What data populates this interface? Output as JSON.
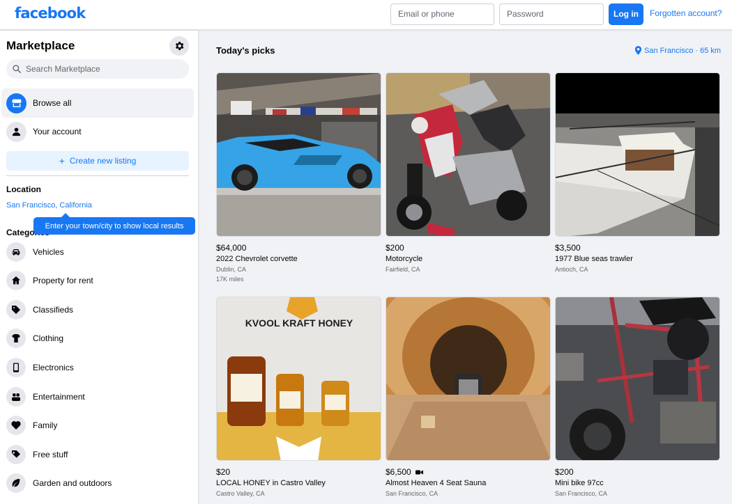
{
  "header": {
    "logo": "facebook",
    "email_placeholder": "Email or phone",
    "password_placeholder": "Password",
    "login_label": "Log in",
    "forgot_label": "Forgotten account?"
  },
  "sidebar": {
    "title": "Marketplace",
    "search_placeholder": "Search Marketplace",
    "nav": [
      {
        "label": "Browse all",
        "icon": "storefront-icon"
      },
      {
        "label": "Your account",
        "icon": "person-icon"
      }
    ],
    "create_label": "Create new listing",
    "location_heading": "Location",
    "location_value": "San Francisco, California",
    "tooltip": "Enter your town/city to show local results",
    "categories_heading": "Categories",
    "categories": [
      {
        "label": "Vehicles",
        "icon": "car-icon"
      },
      {
        "label": "Property for rent",
        "icon": "house-icon"
      },
      {
        "label": "Classifieds",
        "icon": "tag-icon"
      },
      {
        "label": "Clothing",
        "icon": "shirt-icon"
      },
      {
        "label": "Electronics",
        "icon": "phone-icon"
      },
      {
        "label": "Entertainment",
        "icon": "people-icon"
      },
      {
        "label": "Family",
        "icon": "heart-icon"
      },
      {
        "label": "Free stuff",
        "icon": "gift-icon"
      },
      {
        "label": "Garden and outdoors",
        "icon": "leaf-icon"
      }
    ]
  },
  "main": {
    "title": "Today's picks",
    "location": "San Francisco · 65 km",
    "listings": [
      {
        "price": "$64,000",
        "title": "2022 Chevrolet corvette",
        "location": "Dublin, CA",
        "extra": "17K miles",
        "image": "blue-sports-car"
      },
      {
        "price": "$200",
        "title": "Motorcycle",
        "location": "Fairfield, CA",
        "extra": "",
        "image": "red-scooter"
      },
      {
        "price": "$3,500",
        "title": "1977 Blue seas trawler",
        "location": "Antioch, CA",
        "extra": "",
        "image": "white-boat"
      },
      {
        "price": "$20",
        "title": "LOCAL HONEY in Castro Valley",
        "location": "Castro Valley, CA",
        "extra": "",
        "image": "honey-jars",
        "image_text": "KVOOL KRAFT HONEY"
      },
      {
        "price": "$6,500",
        "title": "Almost Heaven 4 Seat Sauna",
        "location": "San Francisco, CA",
        "extra": "",
        "image": "wood-sauna",
        "video": true
      },
      {
        "price": "$200",
        "title": "Mini bike 97cc",
        "location": "San Francisco, CA",
        "extra": "",
        "image": "mini-bike"
      }
    ]
  },
  "colors": {
    "accent": "#1877f2",
    "background": "#f0f2f5"
  }
}
